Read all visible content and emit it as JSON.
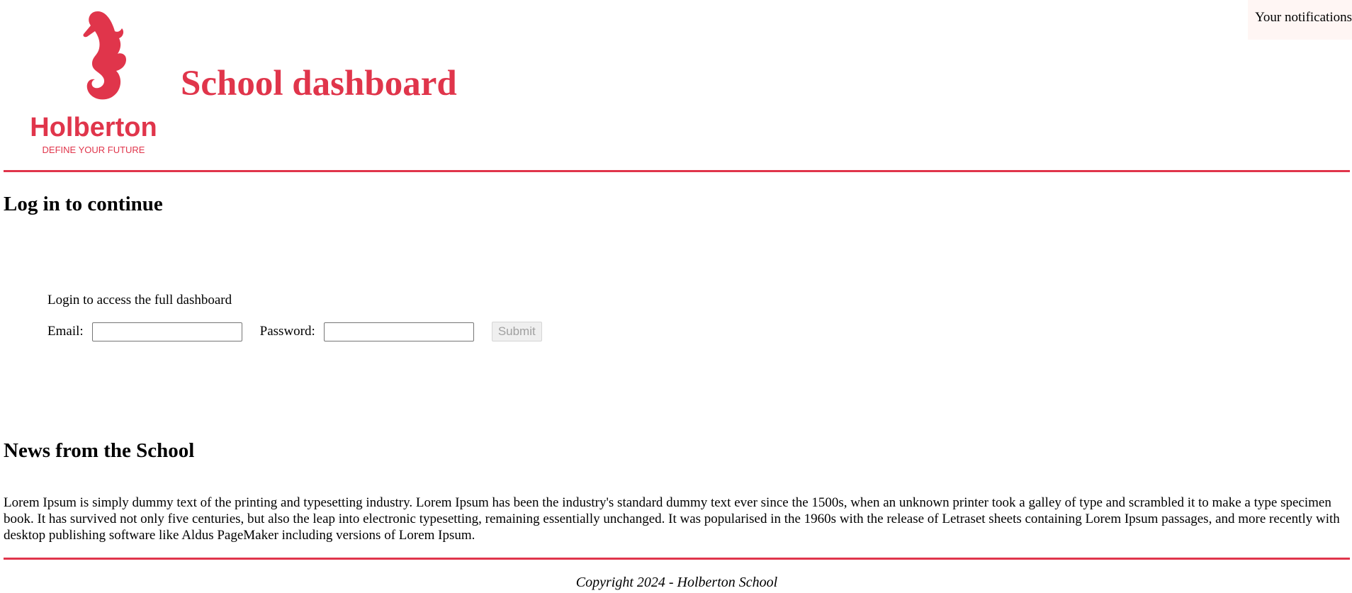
{
  "notifications": {
    "label": "Your notifications"
  },
  "header": {
    "title": "School dashboard",
    "logo": {
      "icon": "seahorse-logo-icon",
      "wordmark": "Holberton",
      "tagline": "DEFINE YOUR FUTURE",
      "color": "#e0354b"
    }
  },
  "login": {
    "heading": "Log in to continue",
    "intro": "Login to access the full dashboard",
    "email_label": "Email:",
    "email_value": "",
    "password_label": "Password:",
    "password_value": "",
    "submit_label": "Submit"
  },
  "news": {
    "heading": "News from the School",
    "body": "Lorem Ipsum is simply dummy text of the printing and typesetting industry. Lorem Ipsum has been the industry's standard dummy text ever since the 1500s, when an unknown printer took a galley of type and scrambled it to make a type specimen book. It has survived not only five centuries, but also the leap into electronic typesetting, remaining essentially unchanged. It was popularised in the 1960s with the release of Letraset sheets containing Lorem Ipsum passages, and more recently with desktop publishing software like Aldus PageMaker including versions of Lorem Ipsum."
  },
  "footer": {
    "copyright": "Copyright 2024 - Holberton School"
  },
  "colors": {
    "accent": "#e0354b",
    "notifications_bg": "#fff6f4"
  }
}
